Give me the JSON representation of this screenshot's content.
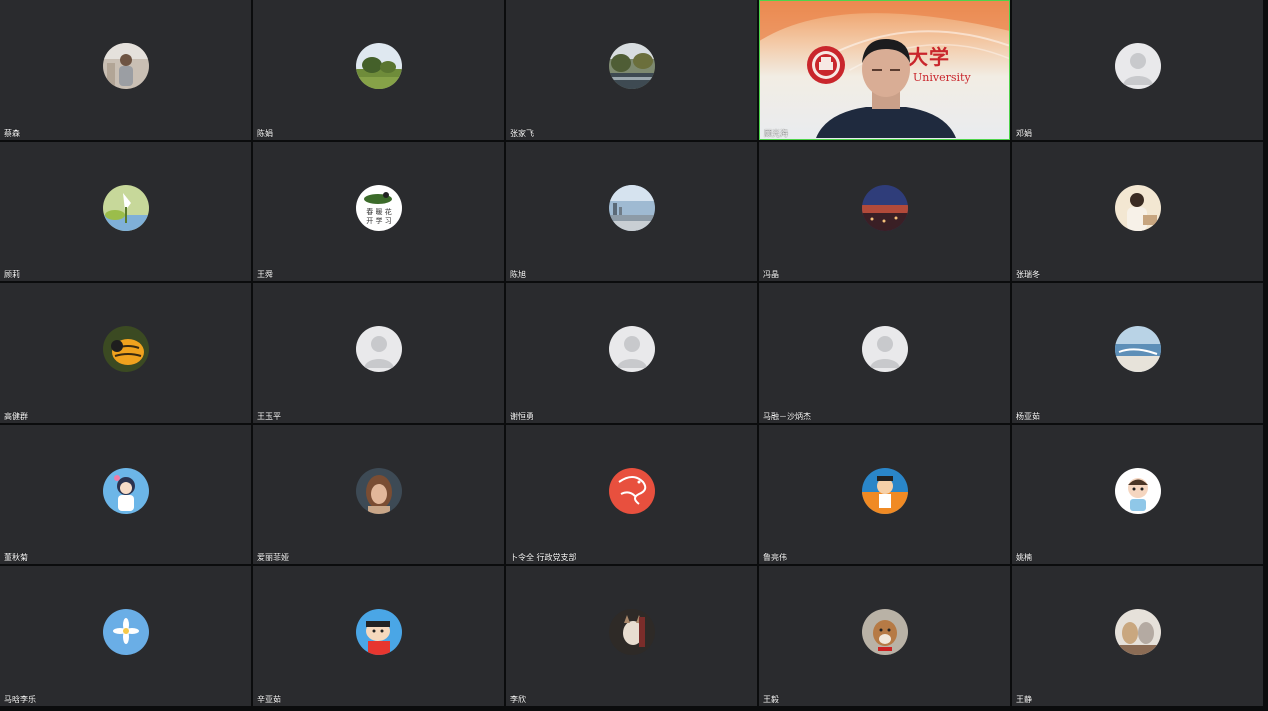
{
  "participants": [
    {
      "name": "蔡森",
      "avatar": "photo-avatar-icon"
    },
    {
      "name": "陈娟",
      "avatar": "landscape-avatar-icon"
    },
    {
      "name": "张家飞",
      "avatar": "scenery-avatar-icon"
    },
    {
      "name": "顾光海",
      "avatar": "video-feed",
      "video": true,
      "logo_text_cn": "大学",
      "logo_text_en": "University"
    },
    {
      "name": "邓娟",
      "avatar": "default-user-icon"
    },
    {
      "name": "顾莉",
      "avatar": "plant-avatar-icon"
    },
    {
      "name": "王舜",
      "avatar": "drawing-avatar-icon"
    },
    {
      "name": "陈旭",
      "avatar": "city-avatar-icon"
    },
    {
      "name": "冯晶",
      "avatar": "sunset-avatar-icon"
    },
    {
      "name": "张瑞冬",
      "avatar": "person-avatar-icon"
    },
    {
      "name": "高健群",
      "avatar": "bee-avatar-icon"
    },
    {
      "name": "王玉平",
      "avatar": "default-user-icon"
    },
    {
      "name": "谢恒勇",
      "avatar": "default-user-icon"
    },
    {
      "name": "马融－沙炳杰",
      "avatar": "default-user-icon"
    },
    {
      "name": "杨亚茹",
      "avatar": "sea-avatar-icon"
    },
    {
      "name": "董秋菊",
      "avatar": "cartoon-girl-avatar-icon"
    },
    {
      "name": "爱丽菲娅",
      "avatar": "woman-avatar-icon"
    },
    {
      "name": "卜令全 行政党支部",
      "avatar": "dragon-avatar-icon"
    },
    {
      "name": "鲁亮伟",
      "avatar": "cartoon-avatar-icon"
    },
    {
      "name": "姚楠",
      "avatar": "cartoon-boy-avatar-icon"
    },
    {
      "name": "马晗李乐",
      "avatar": "flower-avatar-icon"
    },
    {
      "name": "辛亚茹",
      "avatar": "crayon-shin-avatar-icon"
    },
    {
      "name": "李欣",
      "avatar": "cat-avatar-icon"
    },
    {
      "name": "王毅",
      "avatar": "dog-avatar-icon"
    },
    {
      "name": "王静",
      "avatar": "kittens-avatar-icon"
    }
  ],
  "colors": {
    "tile_background": "#2a2b2e",
    "active_speaker_border": "#4fd44c",
    "logo_red": "#c9262c"
  }
}
